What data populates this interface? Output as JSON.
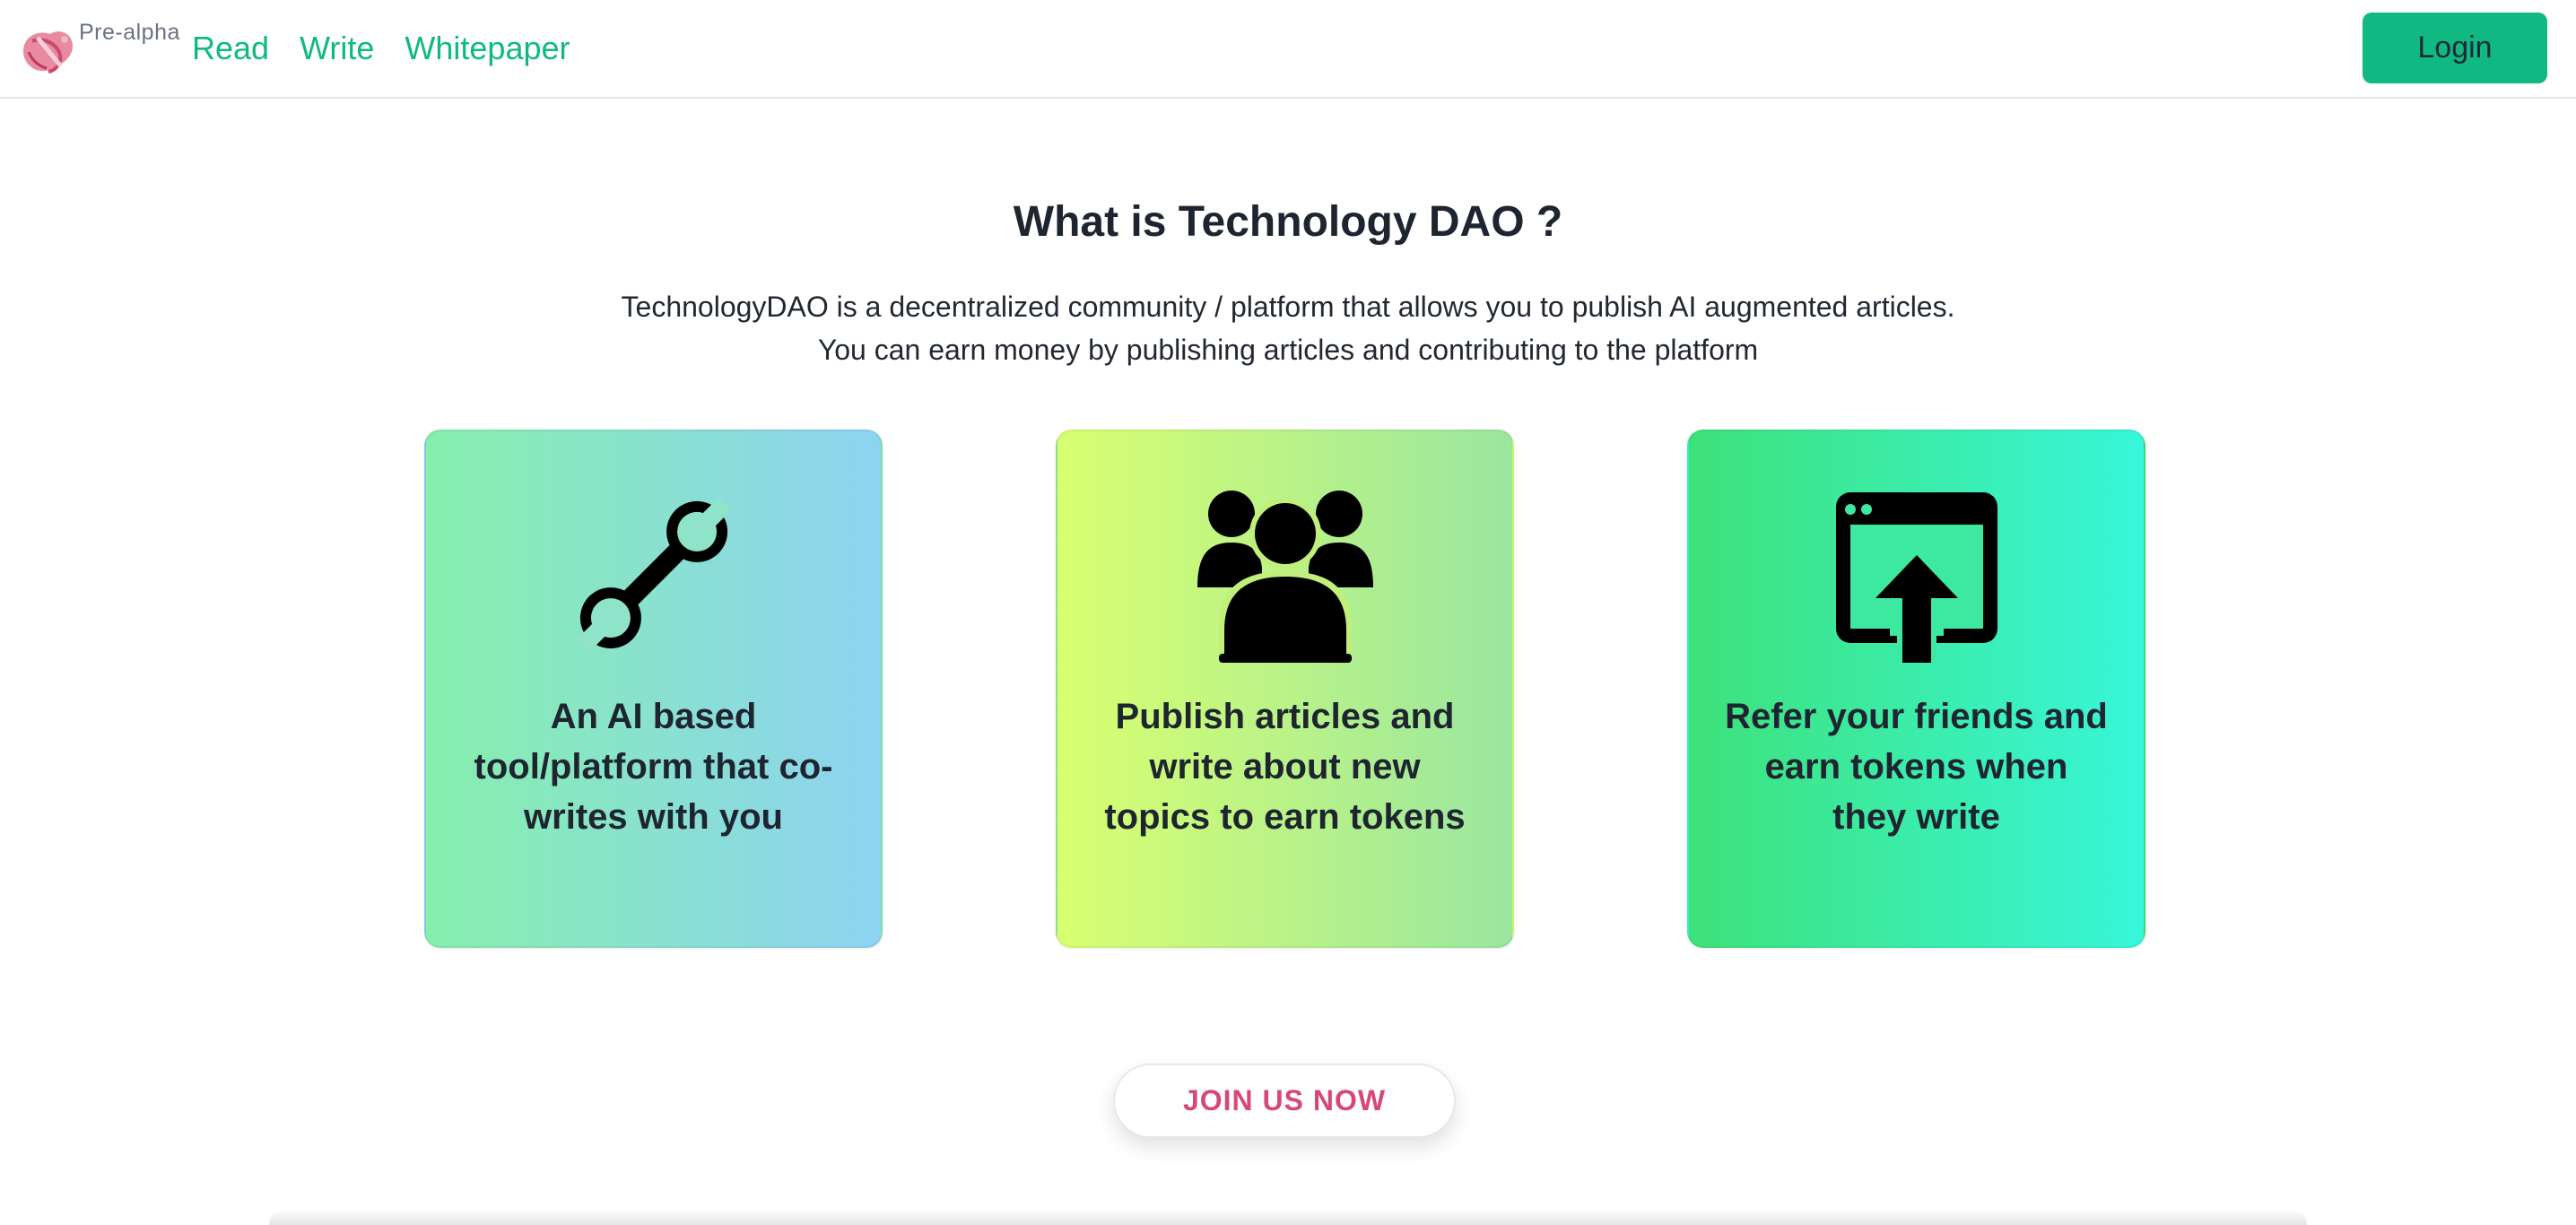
{
  "header": {
    "badge": "Pre-alpha",
    "nav": [
      {
        "label": "Read"
      },
      {
        "label": "Write"
      },
      {
        "label": "Whitepaper"
      }
    ],
    "login_label": "Login",
    "accent_color": "#10b981"
  },
  "hero": {
    "title": "What is Technology DAO ?",
    "description_line1": "TechnologyDAO is a decentralized community / platform that allows you to publish AI augmented articles.",
    "description_line2": "You can earn money by publishing articles and contributing to the platform"
  },
  "cards": [
    {
      "icon": "wrench-icon",
      "text": "An AI based tool/platform that co-writes with you"
    },
    {
      "icon": "users-icon",
      "text": "Publish articles and write about new topics to earn tokens"
    },
    {
      "icon": "window-upload-icon",
      "text": "Refer your friends and earn tokens when they write"
    }
  ],
  "cta": {
    "label": "JOIN US NOW",
    "color": "#d6487a"
  }
}
